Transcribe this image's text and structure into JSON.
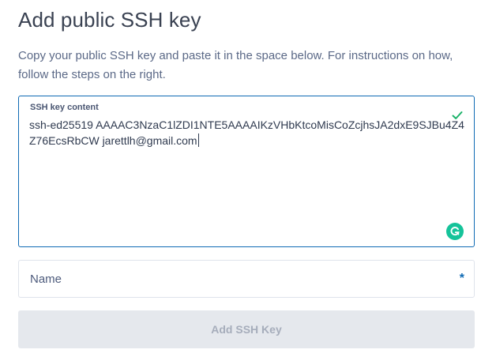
{
  "header": {
    "title": "Add public SSH key",
    "intro": "Copy your public SSH key and paste it in the space below. For instructions on how, follow the steps on the right."
  },
  "ssh_key_field": {
    "label": "SSH key content",
    "value": "ssh-ed25519 AAAAC3NzaC1lZDI1NTE5AAAAIKzVHbKtcoMisCoZcjhsJA2dxE9SJBu4Z4Z76EcsRbCW jarettlh@gmail.com",
    "status_icon": "checkmark-icon",
    "status_color": "#1db36b",
    "assistant_icon": "grammarly-icon"
  },
  "name_field": {
    "placeholder": "Name",
    "required_mark": "*"
  },
  "submit_button": {
    "label": "Add SSH Key",
    "disabled": true
  },
  "colors": {
    "accent": "#0f6ab4",
    "valid": "#1db36b",
    "grammarly": "#15c39a",
    "button_disabled_bg": "#e5e8ed",
    "button_disabled_text": "#a6adbb"
  }
}
